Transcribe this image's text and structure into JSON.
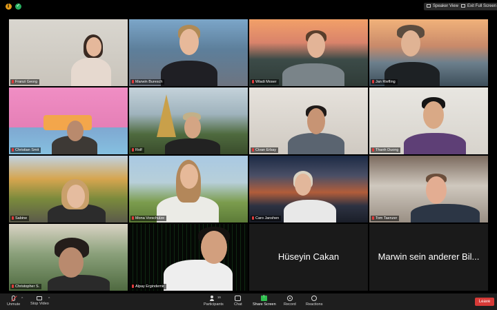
{
  "top_bar": {
    "speaker_view_label": "Speaker View",
    "exit_full_screen_label": "Exit Full Screen"
  },
  "participants": [
    {
      "name": "Franzi Georg"
    },
    {
      "name": "Marwin Buresch",
      "active_speaker": true
    },
    {
      "name": "Wladi Moser"
    },
    {
      "name": "Jan Riefling"
    },
    {
      "name": "Christian Smit"
    },
    {
      "name": "Rolf"
    },
    {
      "name": "Civan Erbay"
    },
    {
      "name": "Thanh Duong"
    },
    {
      "name": "Sabine"
    },
    {
      "name": "Mona Vorschulze"
    },
    {
      "name": "Caro Janshen"
    },
    {
      "name": "Tom Taenzer"
    },
    {
      "name": "Christopher S."
    },
    {
      "name": "Alpay Ergindemir"
    },
    {
      "name": "Hüseyin Cakan",
      "display_text": "Hüseyin Cakan"
    },
    {
      "name": "Marwin sein anderer Bil...",
      "display_text": "Marwin sein anderer Bil..."
    }
  ],
  "toolbar": {
    "unmute_label": "Unmute",
    "stop_video_label": "Stop Video",
    "participants_label": "Participants",
    "participants_count": "16",
    "chat_label": "Chat",
    "share_screen_label": "Share Screen",
    "record_label": "Record",
    "reactions_label": "Reactions",
    "leave_label": "Leave"
  },
  "colors": {
    "active_speaker_border": "#d6c43a",
    "share_green": "#2fbf4f",
    "leave_red": "#d73a37"
  }
}
